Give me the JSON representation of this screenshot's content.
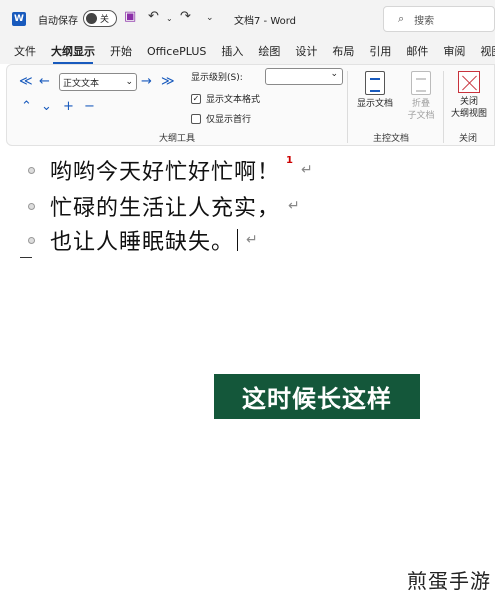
{
  "titlebar": {
    "app_icon_letter": "W",
    "autosave_label": "自动保存",
    "autosave_state": "关",
    "save_icon": "save-icon",
    "undo_icon": "↶",
    "undo_caret": "⌄",
    "redo_icon": "↷",
    "qa_icon": "⌄",
    "doc_title": "文档7 - Word",
    "search_icon": "⌕",
    "search_placeholder": "搜索"
  },
  "tabs": [
    "文件",
    "大纲显示",
    "开始",
    "OfficePLUS",
    "插入",
    "绘图",
    "设计",
    "布局",
    "引用",
    "邮件",
    "审阅",
    "视图"
  ],
  "active_tab_index": 1,
  "ribbon": {
    "outline_tools": {
      "promote_heading": "≪",
      "promote": "←",
      "level_value": "正文文本",
      "level_caret": "⌄",
      "demote": "→",
      "demote_body": "≫",
      "move_up": "⌃",
      "move_down": "⌄",
      "expand": "+",
      "collapse": "−",
      "show_level_label": "显示级别(S):",
      "show_level_value": "⌄",
      "show_text_formatting": "显示文本格式",
      "show_text_formatting_checked": "✓",
      "show_first_line_only": "仅显示首行",
      "group_label": "大纲工具"
    },
    "master_document": {
      "show_document": "显示文档",
      "collapse_subdocs_line1": "折叠",
      "collapse_subdocs_line2": "子文档",
      "group_label": "主控文档"
    },
    "close": {
      "close_outline_line1": "关闭",
      "close_outline_line2": "大纲视图",
      "group_label": "关闭"
    }
  },
  "document": {
    "lines": [
      {
        "text": "哟哟今天好忙好忙啊！",
        "comment_marker": "1",
        "para_mark": "↵"
      },
      {
        "text": "忙碌的生活让人充实，",
        "para_mark": "↵"
      },
      {
        "text": "也让人睡眠缺失。",
        "para_mark": "↵"
      }
    ],
    "caption": "这时候长这样",
    "watermark": "煎蛋手游"
  },
  "colors": {
    "accent": "#185abd",
    "caption_bg": "#14573a",
    "close_red": "#c8323c"
  }
}
